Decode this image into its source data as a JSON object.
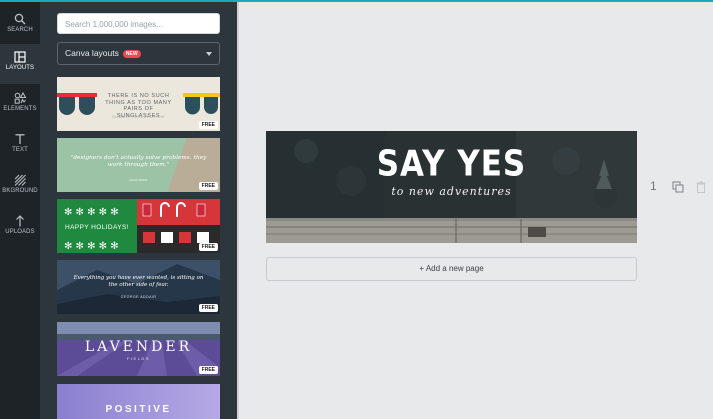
{
  "nav": [
    {
      "label": "SEARCH",
      "icon": "search-icon"
    },
    {
      "label": "LAYOUTS",
      "icon": "layouts-icon"
    },
    {
      "label": "ELEMENTS",
      "icon": "elements-icon"
    },
    {
      "label": "TEXT",
      "icon": "text-icon"
    },
    {
      "label": "BKGROUND",
      "icon": "background-icon"
    },
    {
      "label": "UPLOADS",
      "icon": "uploads-icon"
    }
  ],
  "search": {
    "placeholder": "Search 1,000,000 images..."
  },
  "layout_select": {
    "label": "Canva layouts",
    "badge": "NEW"
  },
  "templates": [
    {
      "text": "THERE IS NO SUCH THING AS TOO MANY PAIRS OF SUNGLASSES",
      "subtext": "SUMMER COLLECTION",
      "badge": "FREE"
    },
    {
      "text": "\"designers don't actually solve problems. they work through them.\"",
      "subtext": "READ MORE",
      "badge": "FREE"
    },
    {
      "text": "HAPPY HOLIDAYS!",
      "badge": "FREE"
    },
    {
      "text": "Everything you have ever wanted, is sitting on the other side of fear.",
      "subtext": "GEORGE ADDAIR",
      "badge": "FREE"
    },
    {
      "text": "LAVENDER",
      "subtext": "FIELDS",
      "badge": "FREE"
    },
    {
      "text": "POSITIVE"
    }
  ],
  "page": {
    "title": "SAY YES",
    "subtitle": "to new adventures",
    "number": "1"
  },
  "add_page": "+ Add a new page",
  "colors": {
    "accent": "#1ea6c9",
    "rail": "#1e2328",
    "panel": "#2d353d",
    "badge": "#f0484e"
  }
}
